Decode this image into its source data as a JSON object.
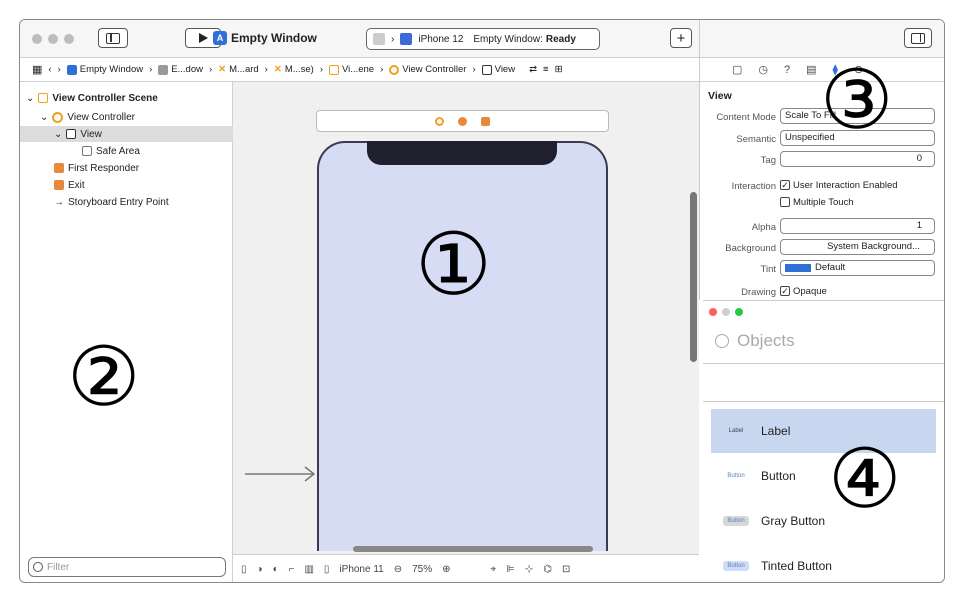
{
  "toolbar": {
    "scheme_title": "Empty Window",
    "device": "iPhone 12",
    "status_prefix": "Empty Window:",
    "status": "Ready",
    "add_label": "+"
  },
  "jump_bar": {
    "crumbs": [
      "Empty Window",
      "E...dow",
      "M...ard",
      "M...se)",
      "Vi...ene",
      "View Controller",
      "View"
    ]
  },
  "navigator": {
    "scene": "View Controller Scene",
    "view_controller": "View Controller",
    "view": "View",
    "safe_area": "Safe Area",
    "first_responder": "First Responder",
    "exit": "Exit",
    "entry_point": "Storyboard Entry Point",
    "filter_placeholder": "Filter"
  },
  "canvas": {
    "device_label": "iPhone 11",
    "zoom": "75%"
  },
  "inspector": {
    "header": "View",
    "content_mode_label": "Content Mode",
    "content_mode_value": "Scale To Fill",
    "semantic_label": "Semantic",
    "semantic_value": "Unspecified",
    "tag_label": "Tag",
    "tag_value": "0",
    "interaction_label": "Interaction",
    "user_interaction": "User Interaction Enabled",
    "multiple_touch": "Multiple Touch",
    "alpha_label": "Alpha",
    "alpha_value": "1",
    "background_label": "Background",
    "background_value": "System Background...",
    "tint_label": "Tint",
    "tint_value": "Default",
    "drawing_label": "Drawing",
    "opaque": "Opaque"
  },
  "library": {
    "search_placeholder": "Objects",
    "items": [
      {
        "thumb": "Label",
        "name": "Label"
      },
      {
        "thumb": "Button",
        "name": "Button"
      },
      {
        "thumb": "Button",
        "name": "Gray Button"
      },
      {
        "thumb": "Button",
        "name": "Tinted Button"
      }
    ]
  },
  "markers": {
    "one": "①",
    "two": "②",
    "three": "③",
    "four": "④"
  },
  "colors": {
    "accent": "#2e6fd8",
    "canvas_view": "#d6dcf4",
    "selection": "#dcdcdc",
    "library_selection": "#c9d6ef",
    "storyboard_orange": "#f0a020"
  }
}
